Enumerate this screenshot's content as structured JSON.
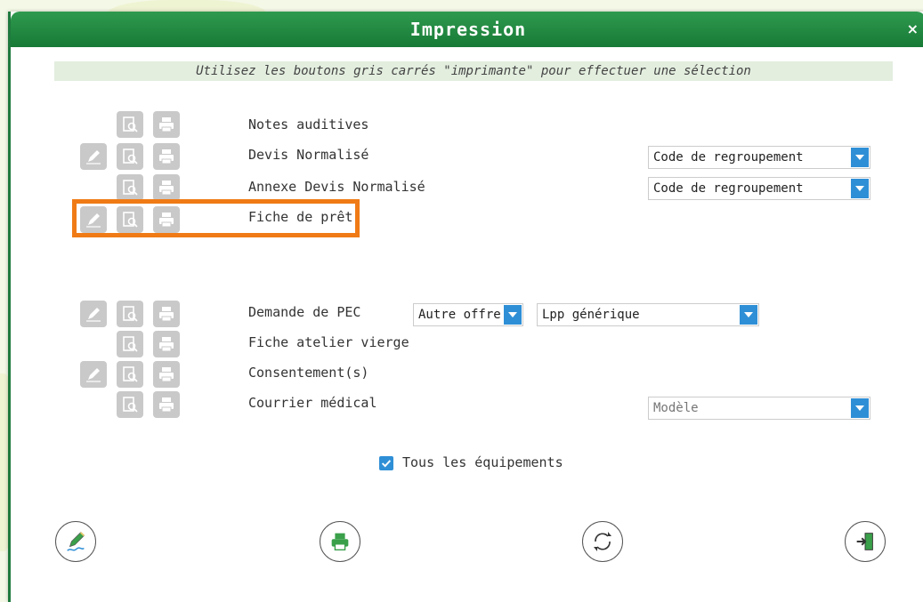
{
  "window": {
    "title": "Impression",
    "close_label": "×"
  },
  "hint": "Utilisez les boutons gris carrés \"imprimante\" pour effectuer une sélection",
  "rows": [
    {
      "label": "Notes auditives"
    },
    {
      "label": "Devis Normalisé",
      "select": "Code de regroupement"
    },
    {
      "label": "Annexe Devis Normalisé",
      "select": "Code de regroupement"
    },
    {
      "label": "Fiche de prêt"
    },
    {
      "label": "Demande de PEC",
      "select_offer": "Autre offre",
      "select_lpp": "Lpp générique"
    },
    {
      "label": "Fiche atelier vierge"
    },
    {
      "label": "Consentement(s)"
    },
    {
      "label": "Courrier médical",
      "select": "Modèle"
    }
  ],
  "checkbox": {
    "label": "Tous les équipements",
    "checked": true
  },
  "icons": {
    "sign": "pen-icon",
    "preview": "preview-icon",
    "print": "printer-icon",
    "footer": [
      "signature-icon",
      "printer-icon",
      "refresh-icon",
      "exit-icon"
    ]
  },
  "colors": {
    "titlebar": "#177a36",
    "highlight": "#f07b16",
    "accent": "#2f8fd6",
    "button_gray": "#c9c9c9"
  }
}
